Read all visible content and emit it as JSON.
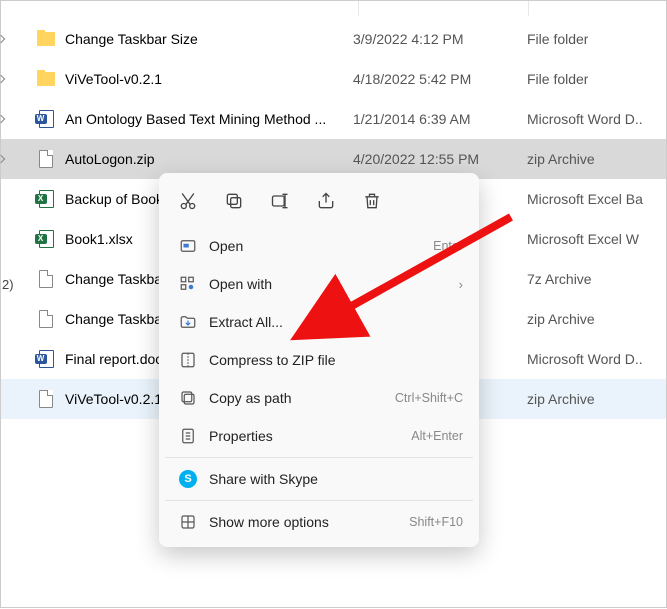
{
  "files": [
    {
      "name": "Change Taskbar Size",
      "date": "3/9/2022 4:12 PM",
      "type": "File folder",
      "icon": "folder",
      "handle": true,
      "selected": false,
      "hover": false
    },
    {
      "name": "ViVeTool-v0.2.1",
      "date": "4/18/2022 5:42 PM",
      "type": "File folder",
      "icon": "folder",
      "handle": true,
      "selected": false,
      "hover": false
    },
    {
      "name": "An Ontology Based Text Mining Method ...",
      "date": "1/21/2014 6:39 AM",
      "type": "Microsoft Word D..",
      "icon": "docx",
      "handle": true,
      "selected": false,
      "hover": false
    },
    {
      "name": "AutoLogon.zip",
      "date": "4/20/2022 12:55 PM",
      "type": "zip Archive",
      "icon": "file",
      "handle": true,
      "selected": true,
      "hover": false
    },
    {
      "name": "Backup of Book1.xlk",
      "date": "",
      "type": "Microsoft Excel Ba",
      "icon": "xlsx",
      "handle": false,
      "selected": false,
      "hover": false
    },
    {
      "name": "Book1.xlsx",
      "date": "",
      "type": "Microsoft Excel W",
      "icon": "xlsx",
      "handle": false,
      "selected": false,
      "hover": false
    },
    {
      "name": "Change Taskbar Size.7z",
      "date": "",
      "type": "7z Archive",
      "icon": "file",
      "handle": false,
      "selected": false,
      "hover": false
    },
    {
      "name": "Change Taskbar Size.zip",
      "date": "",
      "type": "zip Archive",
      "icon": "file",
      "handle": false,
      "selected": false,
      "hover": false
    },
    {
      "name": "Final report.docx",
      "date": "",
      "type": "Microsoft Word D..",
      "icon": "docx",
      "handle": false,
      "selected": false,
      "hover": false
    },
    {
      "name": "ViVeTool-v0.2.1.zip",
      "date": "",
      "type": "zip Archive",
      "icon": "file",
      "handle": false,
      "selected": false,
      "hover": true
    }
  ],
  "side_text": "2)",
  "ctx": {
    "top_icons": [
      "cut-icon",
      "copy-icon",
      "rename-icon",
      "share-icon",
      "delete-icon"
    ],
    "items": [
      {
        "icon": "open-icon",
        "label": "Open",
        "shortcut": "Enter",
        "chevron": false
      },
      {
        "icon": "openwith-icon",
        "label": "Open with",
        "shortcut": "",
        "chevron": true
      },
      {
        "icon": "extract-icon",
        "label": "Extract All...",
        "shortcut": "",
        "chevron": false
      },
      {
        "icon": "compress-icon",
        "label": "Compress to ZIP file",
        "shortcut": "",
        "chevron": false
      },
      {
        "icon": "copypath-icon",
        "label": "Copy as path",
        "shortcut": "Ctrl+Shift+C",
        "chevron": false
      },
      {
        "icon": "properties-icon",
        "label": "Properties",
        "shortcut": "Alt+Enter",
        "chevron": false
      },
      {
        "sep": true
      },
      {
        "icon": "skype-icon",
        "label": "Share with Skype",
        "shortcut": "",
        "chevron": false
      },
      {
        "sep": true
      },
      {
        "icon": "more-icon",
        "label": "Show more options",
        "shortcut": "Shift+F10",
        "chevron": false
      }
    ]
  }
}
